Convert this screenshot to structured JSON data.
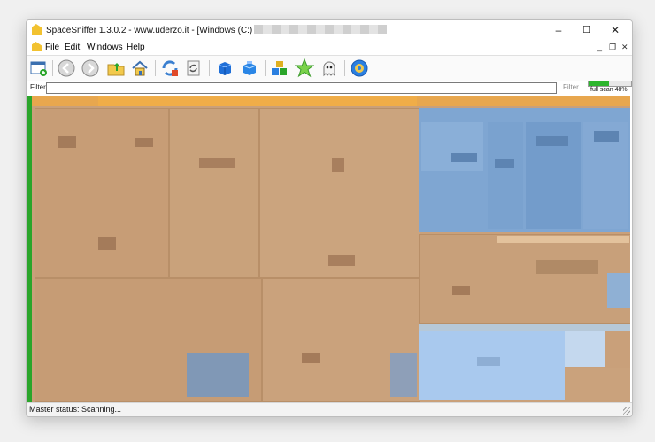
{
  "window": {
    "title": "SpaceSniffer 1.3.0.2 - www.uderzo.it - [Windows (C:)",
    "controls": {
      "minimize": "–",
      "maximize": "☐",
      "close": "✕"
    }
  },
  "menu": {
    "items": [
      "File",
      "Edit",
      "Windows",
      "Help"
    ],
    "mdi": {
      "minimize": "_",
      "restore": "❐",
      "close": "✕"
    }
  },
  "toolbar": {
    "buttons": [
      "new-view-icon",
      "back-icon",
      "forward-icon",
      "up-folder-icon",
      "home-icon",
      "refresh-icon",
      "reload-icon",
      "box-icon",
      "box-open-icon",
      "cubes-icon",
      "star-icon",
      "ghost-icon",
      "settings-gear-icon"
    ]
  },
  "filter": {
    "label": "Filter",
    "button": "Filter",
    "progress_percent": 48,
    "progress_text": "full scan 48%"
  },
  "status": {
    "text": "Master status: Scanning..."
  },
  "colors": {
    "folder": "#c9a07a",
    "file_blue": "#7aa3d4",
    "highlight_blue": "#a9c9ee",
    "header_orange": "#f0a640",
    "green": "#2aa52a"
  }
}
